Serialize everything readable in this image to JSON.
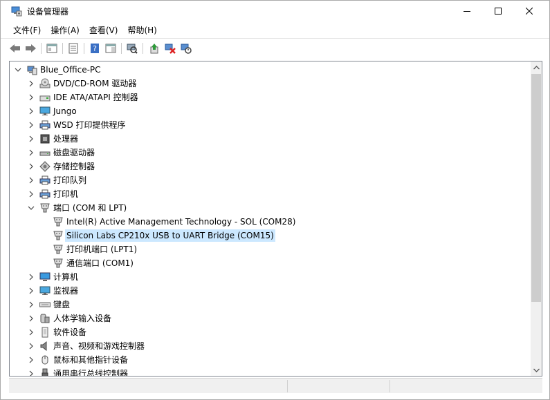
{
  "window": {
    "title": "设备管理器"
  },
  "menu": [
    "文件(F)",
    "操作(A)",
    "查看(V)",
    "帮助(H)"
  ],
  "toolbar_icons": [
    "back-arrow-icon",
    "forward-arrow-icon",
    "show-hide-tree-icon",
    "properties-icon",
    "help-icon",
    "action-pane-icon",
    "scan-hardware-icon",
    "update-driver-icon",
    "uninstall-device-icon",
    "disable-device-icon"
  ],
  "tree": {
    "root": "Blue_Office-PC",
    "items": [
      {
        "label": "DVD/CD-ROM 驱动器",
        "icon": "dvd-drive-icon"
      },
      {
        "label": "IDE ATA/ATAPI 控制器",
        "icon": "ide-controller-icon"
      },
      {
        "label": "Jungo",
        "icon": "monitor-icon"
      },
      {
        "label": "WSD 打印提供程序",
        "icon": "printer-icon"
      },
      {
        "label": "处理器",
        "icon": "processor-icon"
      },
      {
        "label": "磁盘驱动器",
        "icon": "disk-drive-icon"
      },
      {
        "label": "存储控制器",
        "icon": "storage-controller-icon"
      },
      {
        "label": "打印队列",
        "icon": "printer-icon"
      },
      {
        "label": "打印机",
        "icon": "printer-icon"
      },
      {
        "label": "端口 (COM 和 LPT)",
        "icon": "port-icon",
        "expanded": true
      },
      {
        "label": "Intel(R) Active Management Technology - SOL (COM28)",
        "icon": "port-icon",
        "child": true
      },
      {
        "label": "Silicon Labs CP210x USB to UART Bridge (COM15)",
        "icon": "port-icon",
        "child": true,
        "selected": true
      },
      {
        "label": "打印机端口 (LPT1)",
        "icon": "port-icon",
        "child": true
      },
      {
        "label": "通信端口 (COM1)",
        "icon": "port-icon",
        "child": true
      },
      {
        "label": "计算机",
        "icon": "computer-icon"
      },
      {
        "label": "监视器",
        "icon": "monitor-icon"
      },
      {
        "label": "键盘",
        "icon": "keyboard-icon"
      },
      {
        "label": "人体学输入设备",
        "icon": "hid-icon"
      },
      {
        "label": "软件设备",
        "icon": "software-device-icon"
      },
      {
        "label": "声音、视频和游戏控制器",
        "icon": "speaker-icon"
      },
      {
        "label": "鼠标和其他指针设备",
        "icon": "mouse-icon"
      },
      {
        "label": "通用串行总线控制器",
        "icon": "usb-icon"
      }
    ]
  },
  "colors": {
    "selection": "#cce8ff",
    "border": "#828790",
    "scroll_thumb": "#cdcdcd"
  }
}
